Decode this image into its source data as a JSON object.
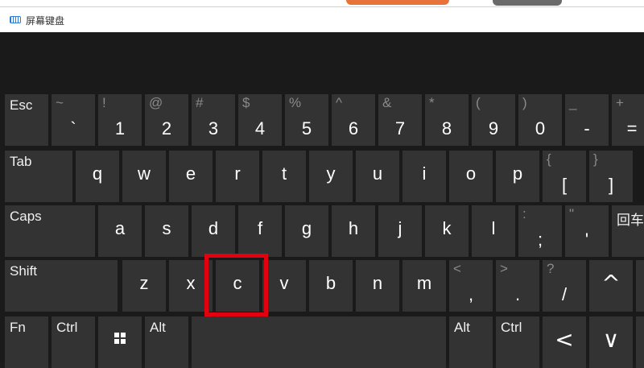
{
  "window": {
    "title": "屏幕键盘",
    "icon": "keyboard-icon"
  },
  "colors": {
    "key_bg": "#333333",
    "board_bg": "#1a1a1a",
    "highlight": "#e3000f"
  },
  "row1": [
    {
      "name": "key-esc",
      "label": "Esc"
    },
    {
      "name": "key-backtick",
      "top": "~",
      "main": "`"
    },
    {
      "name": "key-1",
      "top": "!",
      "main": "1"
    },
    {
      "name": "key-2",
      "top": "@",
      "main": "2"
    },
    {
      "name": "key-3",
      "top": "#",
      "main": "3"
    },
    {
      "name": "key-4",
      "top": "$",
      "main": "4"
    },
    {
      "name": "key-5",
      "top": "%",
      "main": "5"
    },
    {
      "name": "key-6",
      "top": "^",
      "main": "6"
    },
    {
      "name": "key-7",
      "top": "&",
      "main": "7"
    },
    {
      "name": "key-8",
      "top": "*",
      "main": "8"
    },
    {
      "name": "key-9",
      "top": "(",
      "main": "9"
    },
    {
      "name": "key-0",
      "top": ")",
      "main": "0"
    },
    {
      "name": "key-minus",
      "top": "_",
      "main": "-"
    },
    {
      "name": "key-equals",
      "top": "+",
      "main": "="
    }
  ],
  "row2": [
    {
      "name": "key-tab",
      "label": "Tab"
    },
    {
      "name": "key-q",
      "main": "q"
    },
    {
      "name": "key-w",
      "main": "w"
    },
    {
      "name": "key-e",
      "main": "e"
    },
    {
      "name": "key-r",
      "main": "r"
    },
    {
      "name": "key-t",
      "main": "t"
    },
    {
      "name": "key-y",
      "main": "y"
    },
    {
      "name": "key-u",
      "main": "u"
    },
    {
      "name": "key-i",
      "main": "i"
    },
    {
      "name": "key-o",
      "main": "o"
    },
    {
      "name": "key-p",
      "main": "p"
    },
    {
      "name": "key-left-bracket",
      "top": "{",
      "main": "["
    },
    {
      "name": "key-right-bracket",
      "top": "}",
      "main": "]"
    }
  ],
  "row3": [
    {
      "name": "key-caps",
      "label": "Caps"
    },
    {
      "name": "key-a",
      "main": "a"
    },
    {
      "name": "key-s",
      "main": "s"
    },
    {
      "name": "key-d",
      "main": "d"
    },
    {
      "name": "key-f",
      "main": "f"
    },
    {
      "name": "key-g",
      "main": "g"
    },
    {
      "name": "key-h",
      "main": "h"
    },
    {
      "name": "key-j",
      "main": "j"
    },
    {
      "name": "key-k",
      "main": "k"
    },
    {
      "name": "key-l",
      "main": "l"
    },
    {
      "name": "key-semicolon",
      "top": ":",
      "main": ";"
    },
    {
      "name": "key-quote",
      "top": "\"",
      "main": "'"
    },
    {
      "name": "key-enter",
      "label": "回车"
    }
  ],
  "row4": [
    {
      "name": "key-shift",
      "label": "Shift"
    },
    {
      "name": "key-z",
      "main": "z"
    },
    {
      "name": "key-x",
      "main": "x"
    },
    {
      "name": "key-c",
      "main": "c"
    },
    {
      "name": "key-v",
      "main": "v"
    },
    {
      "name": "key-b",
      "main": "b"
    },
    {
      "name": "key-n",
      "main": "n"
    },
    {
      "name": "key-m",
      "main": "m"
    },
    {
      "name": "key-comma",
      "top": "<",
      "main": ","
    },
    {
      "name": "key-period",
      "top": ">",
      "main": "."
    },
    {
      "name": "key-slash",
      "top": "?",
      "main": "/"
    },
    {
      "name": "key-up-arrow",
      "icon": "chevron-up-icon",
      "main": "^"
    },
    {
      "name": "key-right-shift",
      "label": ""
    }
  ],
  "row5": [
    {
      "name": "key-fn",
      "label": "Fn"
    },
    {
      "name": "key-ctrl",
      "label": "Ctrl"
    },
    {
      "name": "key-windows",
      "icon": "windows-logo-icon"
    },
    {
      "name": "key-alt",
      "label": "Alt"
    },
    {
      "name": "key-space",
      "label": ""
    },
    {
      "name": "key-right-alt",
      "label": "Alt"
    },
    {
      "name": "key-right-ctrl",
      "label": "Ctrl"
    },
    {
      "name": "key-left-arrow",
      "icon": "chevron-left-icon",
      "main": "<"
    },
    {
      "name": "key-down-arrow",
      "icon": "chevron-down-icon",
      "main": "∨"
    },
    {
      "name": "key-right-arrow",
      "icon": "chevron-right-icon",
      "main": ""
    }
  ]
}
